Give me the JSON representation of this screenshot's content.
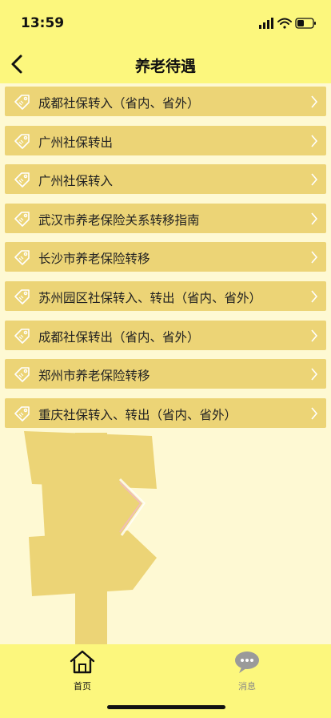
{
  "status_bar": {
    "time": "13:59"
  },
  "nav": {
    "title": "养老待遇"
  },
  "list": [
    "成都社保转入（省内、省外）",
    "广州社保转出",
    "广州社保转入",
    "武汉市养老保险关系转移指南",
    "长沙市养老保险转移",
    "苏州园区社保转入、转出（省内、省外）",
    "成都社保转出（省内、省外）",
    "郑州市养老保险转移",
    "重庆社保转入、转出（省内、省外）"
  ],
  "tabs": [
    {
      "label": "首页",
      "icon": "home-icon",
      "active": true
    },
    {
      "label": "消息",
      "icon": "chat-icon",
      "active": false
    }
  ],
  "colors": {
    "header": "#fcf77d",
    "item": "#ecd476",
    "background": "#fef9d3",
    "sign": "#ecd476"
  }
}
